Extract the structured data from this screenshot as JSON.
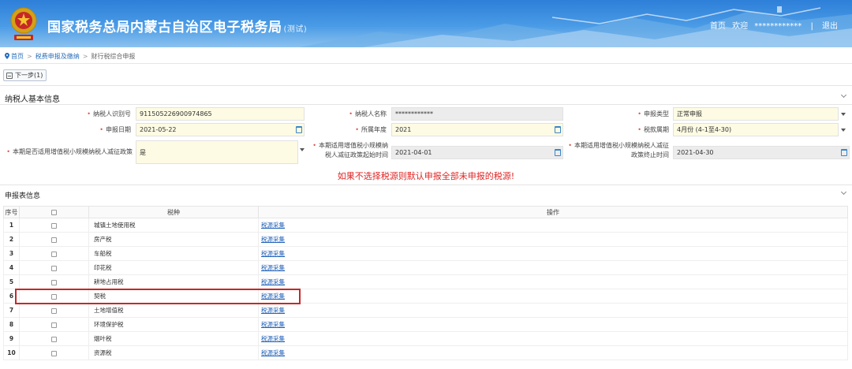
{
  "header": {
    "title": "国家税务总局内蒙古自治区电子税务局",
    "title_suffix": "(测试)",
    "nav": {
      "home": "首页",
      "welcome": "欢迎",
      "username": "************",
      "separator": "|",
      "logout": "退出"
    },
    "colors": {
      "header_blue": "#2d7fd8",
      "required": "#d9534f",
      "notice": "#e02424",
      "highlight": "#c62828"
    }
  },
  "breadcrumb": {
    "home": "首页",
    "level1": "税费申报及缴纳",
    "current": "财行税综合申报",
    "separator": ">"
  },
  "toolbar": {
    "next_label": "下一步(1)"
  },
  "basic_info": {
    "title": "纳税人基本信息",
    "fields": {
      "taxpayer_id": {
        "label": "纳税人识别号",
        "value": "911505226900974865"
      },
      "taxpayer_name": {
        "label": "纳税人名称",
        "value": "************"
      },
      "declare_type": {
        "label": "申报类型",
        "value": "正常申报"
      },
      "declare_date": {
        "label": "申报日期",
        "value": "2021-05-22"
      },
      "tax_year": {
        "label": "所属年度",
        "value": "2021"
      },
      "tax_period": {
        "label": "税款属期",
        "value": "4月份 (4-1至4-30)"
      },
      "small_scale_policy": {
        "label": "本期是否适用增值税小规模纳税人减征政策",
        "value": "是"
      },
      "policy_start": {
        "label_line1": "本期适用增值税小规模纳",
        "label_line2": "税人减征政策起始时间",
        "value": "2021-04-01"
      },
      "policy_end": {
        "label_line1": "本期适用增值税小规模纳税人减征",
        "label_line2": "政策终止时间",
        "value": "2021-04-30"
      }
    }
  },
  "notice": "如果不选择税源则默认申报全部未申报的税源!",
  "declare_table": {
    "title": "申报表信息",
    "headers": {
      "index": "序号",
      "tax_type": "税种",
      "operation": "操作"
    },
    "rows": [
      {
        "index": "1",
        "tax": "城镇土地使用税",
        "op": "税源采集"
      },
      {
        "index": "2",
        "tax": "房产税",
        "op": "税源采集"
      },
      {
        "index": "3",
        "tax": "车船税",
        "op": "税源采集"
      },
      {
        "index": "4",
        "tax": "印花税",
        "op": "税源采集"
      },
      {
        "index": "5",
        "tax": "耕地占用税",
        "op": "税源采集"
      },
      {
        "index": "6",
        "tax": "契税",
        "op": "税源采集"
      },
      {
        "index": "7",
        "tax": "土地增值税",
        "op": "税源采集"
      },
      {
        "index": "8",
        "tax": "环境保护税",
        "op": "税源采集"
      },
      {
        "index": "9",
        "tax": "烟叶税",
        "op": "税源采集"
      },
      {
        "index": "10",
        "tax": "资源税",
        "op": "税源采集"
      }
    ],
    "highlighted_row_index": "6"
  }
}
